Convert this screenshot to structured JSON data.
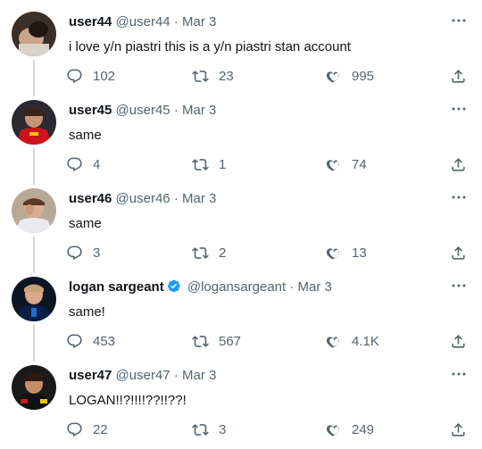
{
  "tweets": [
    {
      "name": "user44",
      "handle": "@user44",
      "separator": "·",
      "date": "Mar 3",
      "text": "i love y/n piastri this is a y/n piastri stan account",
      "replies": "102",
      "retweets": "23",
      "likes": "995",
      "verified": false
    },
    {
      "name": "user45",
      "handle": "@user45",
      "separator": "·",
      "date": "Mar 3",
      "text": "same",
      "replies": "4",
      "retweets": "1",
      "likes": "74",
      "verified": false
    },
    {
      "name": "user46",
      "handle": "@user46",
      "separator": "·",
      "date": "Mar 3",
      "text": "same",
      "replies": "3",
      "retweets": "2",
      "likes": "13",
      "verified": false
    },
    {
      "name": "logan sargeant",
      "handle": "@logansargeant",
      "separator": "·",
      "date": "Mar 3",
      "text": "same!",
      "replies": "453",
      "retweets": "567",
      "likes": "4.1K",
      "verified": true
    },
    {
      "name": "user47",
      "handle": "@user47",
      "separator": "·",
      "date": "Mar 3",
      "text": "LOGAN!!?!!!!??!!??!",
      "replies": "22",
      "retweets": "3",
      "likes": "249",
      "verified": false
    }
  ],
  "icons": {
    "more": "more-icon",
    "reply": "reply-icon",
    "retweet": "retweet-icon",
    "like": "like-icon",
    "share": "share-icon",
    "verified": "verified-badge-icon"
  },
  "colors": {
    "text": "#0f1419",
    "secondary": "#536471",
    "verified": "#1d9bf0",
    "thread_line": "#cfd9de"
  }
}
